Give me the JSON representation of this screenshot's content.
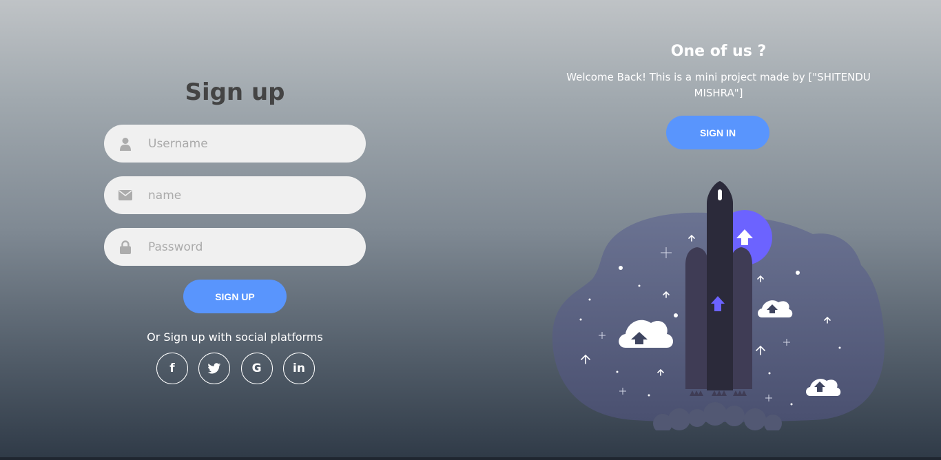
{
  "signup": {
    "title": "Sign up",
    "fields": [
      {
        "icon": "user-icon",
        "placeholder": "Username",
        "value": ""
      },
      {
        "icon": "envelope-icon",
        "placeholder": "name",
        "value": ""
      },
      {
        "icon": "lock-icon",
        "placeholder": "Password",
        "value": ""
      }
    ],
    "submit_label": "SIGN UP",
    "social_text": "Or Sign up with social platforms",
    "social": [
      {
        "icon": "facebook-icon",
        "glyph": "f"
      },
      {
        "icon": "twitter-icon",
        "glyph": "🐦"
      },
      {
        "icon": "google-icon",
        "glyph": "G"
      },
      {
        "icon": "linkedin-icon",
        "glyph": "in"
      }
    ]
  },
  "panel": {
    "title": "One of us ?",
    "text": "Welcome Back! This is a mini project made by [\"SHITENDU MISHRA\"]",
    "button_label": "SIGN IN"
  },
  "colors": {
    "accent": "#5995fd",
    "title": "#444444",
    "field_bg": "#f0f0f0",
    "rocket_dark": "#2b2a3a",
    "rocket_side": "#3f3c55",
    "purple": "#6c63ff",
    "blob": "#5d6587"
  }
}
